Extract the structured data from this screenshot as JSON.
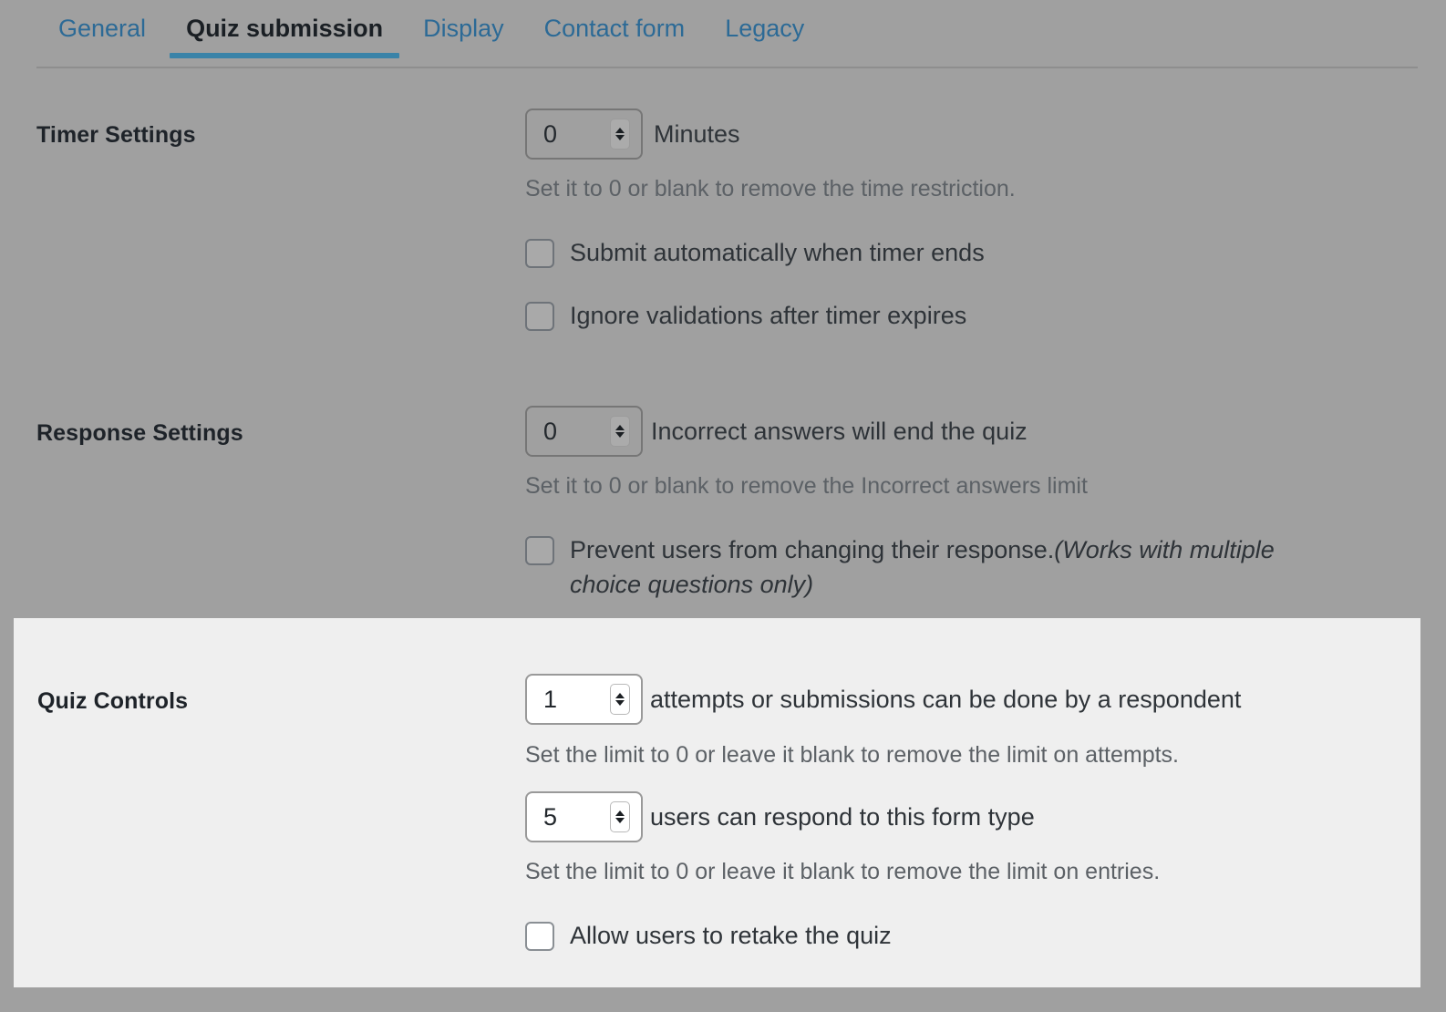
{
  "tabs": [
    {
      "label": "General",
      "active": false
    },
    {
      "label": "Quiz submission",
      "active": true
    },
    {
      "label": "Display",
      "active": false
    },
    {
      "label": "Contact form",
      "active": false
    },
    {
      "label": "Legacy",
      "active": false
    }
  ],
  "colors": {
    "page_background": "#a0a0a0",
    "highlight_background": "#efefef",
    "tab_link": "#2c6a96",
    "tab_active_underline": "#3a83a8",
    "tab_active_text": "#1a1f24",
    "label_text": "#1e2329",
    "body_text": "#2e3338",
    "help_text": "#5c6166"
  },
  "sections": {
    "timer": {
      "label": "Timer Settings",
      "minutes_value": "0",
      "minutes_unit": "Minutes",
      "help": "Set it to 0 or blank to remove the time restriction.",
      "checkbox_submit_auto": {
        "label": "Submit automatically when timer ends",
        "checked": false
      },
      "checkbox_ignore_validations": {
        "label": "Ignore validations after timer expires",
        "checked": false
      }
    },
    "response": {
      "label": "Response Settings",
      "incorrect_value": "0",
      "incorrect_suffix": "Incorrect answers will end the quiz",
      "help": "Set it to 0 or blank to remove the Incorrect answers limit",
      "checkbox_prevent_change": {
        "label_main": "Prevent users from changing their response.",
        "label_italic": "(Works with multiple choice questions only)",
        "checked": false
      }
    },
    "quiz_controls": {
      "label": "Quiz Controls",
      "attempts_value": "1",
      "attempts_suffix": "attempts or submissions can be done by a respondent",
      "attempts_help": "Set the limit to 0 or leave it blank to remove the limit on attempts.",
      "entries_value": "5",
      "entries_suffix": "users can respond to this form type",
      "entries_help": "Set the limit to 0 or leave it blank to remove the limit on entries.",
      "checkbox_retake": {
        "label": "Allow users to retake the quiz",
        "checked": false
      }
    }
  }
}
